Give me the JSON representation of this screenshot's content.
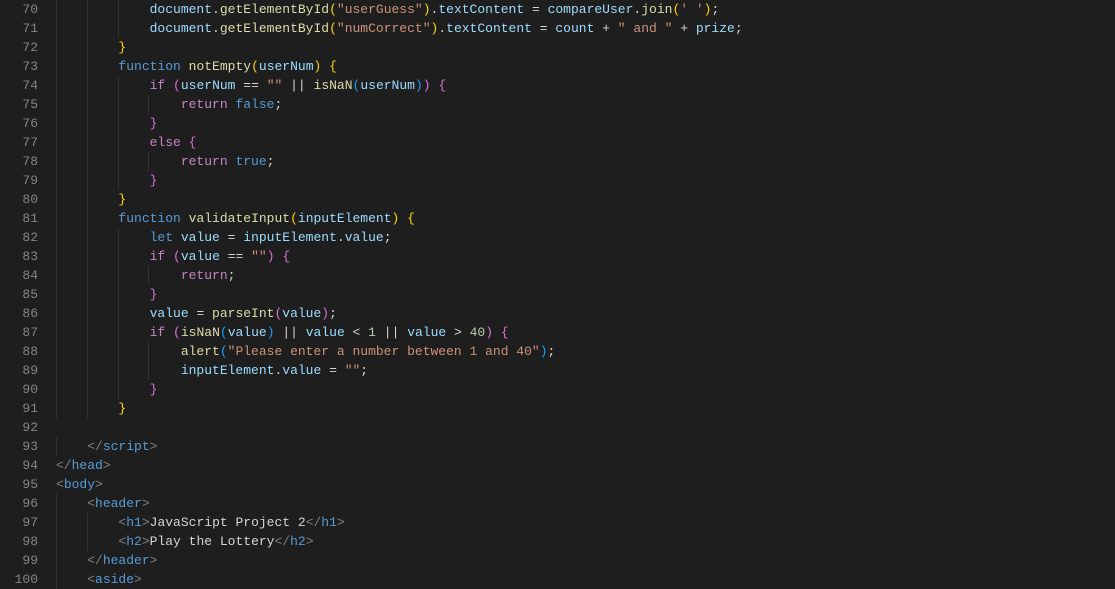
{
  "lines": [
    70,
    71,
    72,
    73,
    74,
    75,
    76,
    77,
    78,
    79,
    80,
    81,
    82,
    83,
    84,
    85,
    86,
    87,
    88,
    89,
    90,
    91,
    92,
    93,
    94,
    95,
    96,
    97,
    98,
    99,
    100
  ],
  "code": {
    "l70": {
      "indent": 3,
      "tokens": [
        [
          "var",
          "document"
        ],
        [
          "pun",
          "."
        ],
        [
          "fn",
          "getElementById"
        ],
        [
          "ylw",
          "("
        ],
        [
          "str",
          "\"userGuess\""
        ],
        [
          "ylw",
          ")"
        ],
        [
          "pun",
          "."
        ],
        [
          "var",
          "textContent"
        ],
        [
          "pun",
          " = "
        ],
        [
          "var",
          "compareUser"
        ],
        [
          "pun",
          "."
        ],
        [
          "fn",
          "join"
        ],
        [
          "ylw",
          "("
        ],
        [
          "str",
          "' '"
        ],
        [
          "ylw",
          ")"
        ],
        [
          "pun",
          ";"
        ]
      ]
    },
    "l71": {
      "indent": 3,
      "tokens": [
        [
          "var",
          "document"
        ],
        [
          "pun",
          "."
        ],
        [
          "fn",
          "getElementById"
        ],
        [
          "ylw",
          "("
        ],
        [
          "str",
          "\"numCorrect\""
        ],
        [
          "ylw",
          ")"
        ],
        [
          "pun",
          "."
        ],
        [
          "var",
          "textContent"
        ],
        [
          "pun",
          " = "
        ],
        [
          "var",
          "count"
        ],
        [
          "pun",
          " + "
        ],
        [
          "str",
          "\" and \""
        ],
        [
          "pun",
          " + "
        ],
        [
          "var",
          "prize"
        ],
        [
          "pun",
          ";"
        ]
      ]
    },
    "l72": {
      "indent": 2,
      "tokens": [
        [
          "ylw",
          "}"
        ]
      ]
    },
    "l73": {
      "indent": 2,
      "tokens": [
        [
          "kw",
          "function"
        ],
        [
          "pun",
          " "
        ],
        [
          "fn",
          "notEmpty"
        ],
        [
          "ylw",
          "("
        ],
        [
          "var",
          "userNum"
        ],
        [
          "ylw",
          ")"
        ],
        [
          "pun",
          " "
        ],
        [
          "ylw",
          "{"
        ]
      ]
    },
    "l74": {
      "indent": 3,
      "tokens": [
        [
          "kw2",
          "if"
        ],
        [
          "pun",
          " "
        ],
        [
          "pnk",
          "("
        ],
        [
          "var",
          "userNum"
        ],
        [
          "pun",
          " == "
        ],
        [
          "str",
          "\"\""
        ],
        [
          "pun",
          " || "
        ],
        [
          "fn",
          "isNaN"
        ],
        [
          "blu-b",
          "("
        ],
        [
          "var",
          "userNum"
        ],
        [
          "blu-b",
          ")"
        ],
        [
          "pnk",
          ")"
        ],
        [
          "pun",
          " "
        ],
        [
          "pnk",
          "{"
        ]
      ]
    },
    "l75": {
      "indent": 4,
      "tokens": [
        [
          "kw2",
          "return"
        ],
        [
          "pun",
          " "
        ],
        [
          "bool",
          "false"
        ],
        [
          "pun",
          ";"
        ]
      ]
    },
    "l76": {
      "indent": 3,
      "tokens": [
        [
          "pnk",
          "}"
        ]
      ]
    },
    "l77": {
      "indent": 3,
      "tokens": [
        [
          "kw2",
          "else"
        ],
        [
          "pun",
          " "
        ],
        [
          "pnk",
          "{"
        ]
      ]
    },
    "l78": {
      "indent": 4,
      "tokens": [
        [
          "kw2",
          "return"
        ],
        [
          "pun",
          " "
        ],
        [
          "bool",
          "true"
        ],
        [
          "pun",
          ";"
        ]
      ]
    },
    "l79": {
      "indent": 3,
      "tokens": [
        [
          "pnk",
          "}"
        ]
      ]
    },
    "l80": {
      "indent": 2,
      "tokens": [
        [
          "ylw",
          "}"
        ]
      ]
    },
    "l81": {
      "indent": 2,
      "tokens": [
        [
          "kw",
          "function"
        ],
        [
          "pun",
          " "
        ],
        [
          "fn",
          "validateInput"
        ],
        [
          "ylw",
          "("
        ],
        [
          "var",
          "inputElement"
        ],
        [
          "ylw",
          ")"
        ],
        [
          "pun",
          " "
        ],
        [
          "ylw",
          "{"
        ]
      ]
    },
    "l82": {
      "indent": 3,
      "tokens": [
        [
          "kw",
          "let"
        ],
        [
          "pun",
          " "
        ],
        [
          "var",
          "value"
        ],
        [
          "pun",
          " = "
        ],
        [
          "var",
          "inputElement"
        ],
        [
          "pun",
          "."
        ],
        [
          "var",
          "value"
        ],
        [
          "pun",
          ";"
        ]
      ]
    },
    "l83": {
      "indent": 3,
      "tokens": [
        [
          "kw2",
          "if"
        ],
        [
          "pun",
          " "
        ],
        [
          "pnk",
          "("
        ],
        [
          "var",
          "value"
        ],
        [
          "pun",
          " == "
        ],
        [
          "str",
          "\"\""
        ],
        [
          "pnk",
          ")"
        ],
        [
          "pun",
          " "
        ],
        [
          "pnk",
          "{"
        ]
      ]
    },
    "l84": {
      "indent": 4,
      "tokens": [
        [
          "kw2",
          "return"
        ],
        [
          "pun",
          ";"
        ]
      ]
    },
    "l85": {
      "indent": 3,
      "tokens": [
        [
          "pnk",
          "}"
        ]
      ]
    },
    "l86": {
      "indent": 3,
      "tokens": [
        [
          "var",
          "value"
        ],
        [
          "pun",
          " = "
        ],
        [
          "fn",
          "parseInt"
        ],
        [
          "pnk",
          "("
        ],
        [
          "var",
          "value"
        ],
        [
          "pnk",
          ")"
        ],
        [
          "pun",
          ";"
        ]
      ]
    },
    "l87": {
      "indent": 3,
      "tokens": [
        [
          "kw2",
          "if"
        ],
        [
          "pun",
          " "
        ],
        [
          "pnk",
          "("
        ],
        [
          "fn",
          "isNaN"
        ],
        [
          "blu-b",
          "("
        ],
        [
          "var",
          "value"
        ],
        [
          "blu-b",
          ")"
        ],
        [
          "pun",
          " || "
        ],
        [
          "var",
          "value"
        ],
        [
          "pun",
          " < "
        ],
        [
          "num",
          "1"
        ],
        [
          "pun",
          " || "
        ],
        [
          "var",
          "value"
        ],
        [
          "pun",
          " > "
        ],
        [
          "num",
          "40"
        ],
        [
          "pnk",
          ")"
        ],
        [
          "pun",
          " "
        ],
        [
          "pnk",
          "{"
        ]
      ]
    },
    "l88": {
      "indent": 4,
      "tokens": [
        [
          "fn",
          "alert"
        ],
        [
          "blu-b",
          "("
        ],
        [
          "str",
          "\"Please enter a number between 1 and 40\""
        ],
        [
          "blu-b",
          ")"
        ],
        [
          "pun",
          ";"
        ]
      ]
    },
    "l89": {
      "indent": 4,
      "tokens": [
        [
          "var",
          "inputElement"
        ],
        [
          "pun",
          "."
        ],
        [
          "var",
          "value"
        ],
        [
          "pun",
          " = "
        ],
        [
          "str",
          "\"\""
        ],
        [
          "pun",
          ";"
        ]
      ]
    },
    "l90": {
      "indent": 3,
      "tokens": [
        [
          "pnk",
          "}"
        ]
      ]
    },
    "l91": {
      "indent": 2,
      "tokens": [
        [
          "ylw",
          "}"
        ]
      ]
    },
    "l92": {
      "indent": 0,
      "tokens": []
    },
    "l93": {
      "indent": 1,
      "tokens": [
        [
          "tagp",
          "</"
        ],
        [
          "tag",
          "script"
        ],
        [
          "tagp",
          ">"
        ]
      ]
    },
    "l94": {
      "indent": 0,
      "tokens": [
        [
          "tagp",
          "</"
        ],
        [
          "tag",
          "head"
        ],
        [
          "tagp",
          ">"
        ]
      ]
    },
    "l95": {
      "indent": 0,
      "tokens": [
        [
          "tagp",
          "<"
        ],
        [
          "tag",
          "body"
        ],
        [
          "tagp",
          ">"
        ]
      ]
    },
    "l96": {
      "indent": 1,
      "tokens": [
        [
          "tagp",
          "<"
        ],
        [
          "tag",
          "header"
        ],
        [
          "tagp",
          ">"
        ]
      ]
    },
    "l97": {
      "indent": 2,
      "tokens": [
        [
          "tagp",
          "<"
        ],
        [
          "tag",
          "h1"
        ],
        [
          "tagp",
          ">"
        ],
        [
          "pun",
          "JavaScript Project 2"
        ],
        [
          "tagp",
          "</"
        ],
        [
          "tag",
          "h1"
        ],
        [
          "tagp",
          ">"
        ]
      ]
    },
    "l98": {
      "indent": 2,
      "tokens": [
        [
          "tagp",
          "<"
        ],
        [
          "tag",
          "h2"
        ],
        [
          "tagp",
          ">"
        ],
        [
          "pun",
          "Play the Lottery"
        ],
        [
          "tagp",
          "</"
        ],
        [
          "tag",
          "h2"
        ],
        [
          "tagp",
          ">"
        ]
      ]
    },
    "l99": {
      "indent": 1,
      "tokens": [
        [
          "tagp",
          "</"
        ],
        [
          "tag",
          "header"
        ],
        [
          "tagp",
          ">"
        ]
      ]
    },
    "l100": {
      "indent": 1,
      "tokens": [
        [
          "tagp",
          "<"
        ],
        [
          "tag",
          "aside"
        ],
        [
          "tagp",
          ">"
        ]
      ]
    }
  }
}
